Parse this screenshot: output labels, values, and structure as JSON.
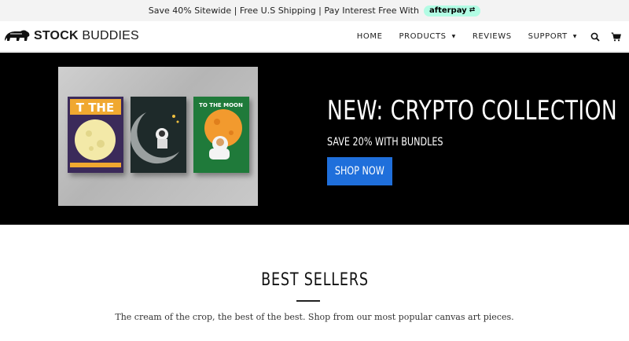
{
  "announcement": {
    "text": "Save 40% Sitewide | Free U.S Shipping | Pay Interest Free With",
    "afterpay_label": "afterpay",
    "afterpay_color": "#b2fce4"
  },
  "header": {
    "logo_strong": "STOCK",
    "logo_light": "BUDDIES",
    "nav": [
      {
        "label": "HOME",
        "dropdown": false
      },
      {
        "label": "PRODUCTS",
        "dropdown": true
      },
      {
        "label": "REVIEWS",
        "dropdown": false
      },
      {
        "label": "SUPPORT",
        "dropdown": true
      }
    ],
    "icons": [
      "search-icon",
      "cart-icon"
    ]
  },
  "hero": {
    "title": "NEW: CRYPTO COLLECTION",
    "subtitle": "SAVE 20% WITH BUNDLES",
    "button_label": "SHOP NOW",
    "button_color": "#1f6fdb",
    "background": "#000000",
    "canvas_1_text": "T THE",
    "canvas_3_text": "TO THE MOON"
  },
  "best_sellers": {
    "title": "BEST SELLERS",
    "description": "The cream of the crop, the best of the best. Shop from our most popular canvas art pieces."
  }
}
